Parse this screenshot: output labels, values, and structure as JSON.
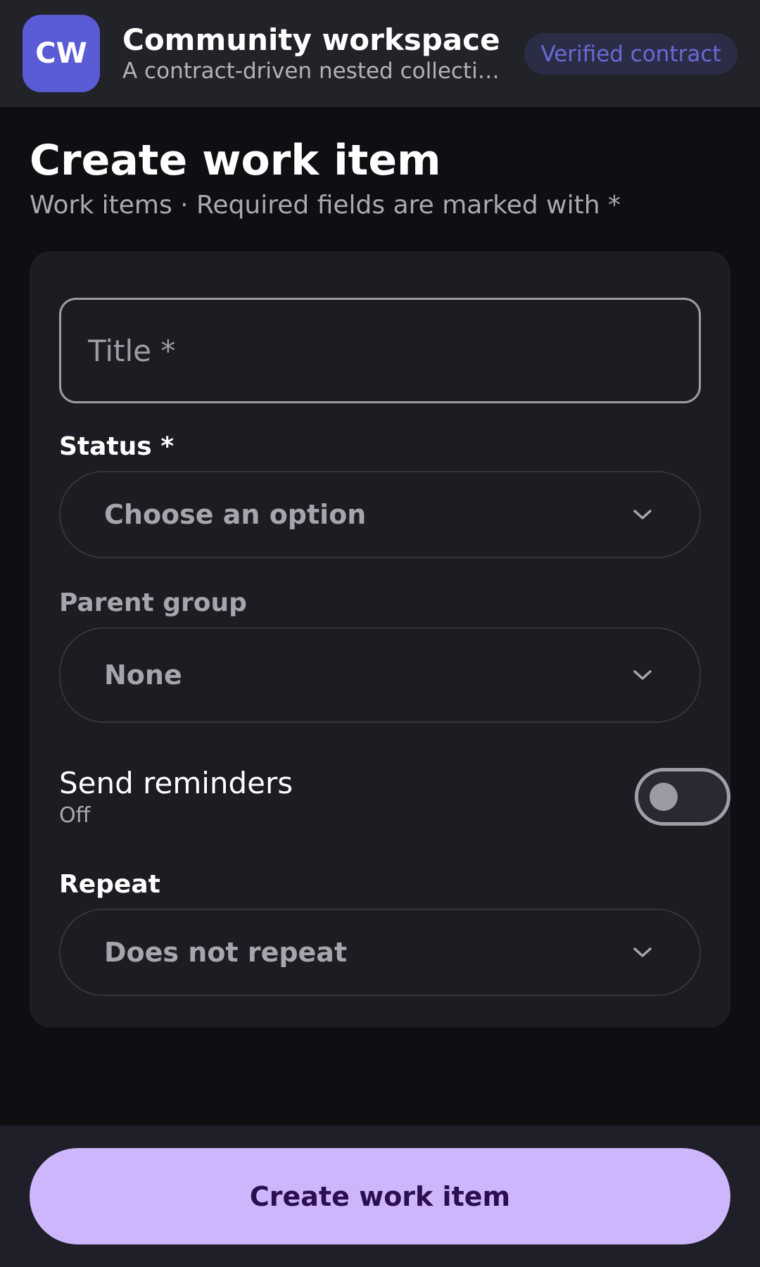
{
  "header": {
    "logo_initials": "CW",
    "title": "Community workspace",
    "subtitle": "A contract-driven nested collection editor",
    "badge": "Verified contract"
  },
  "page": {
    "title": "Create work item",
    "subtitle": "Work items · Required fields are marked with *"
  },
  "form": {
    "title_field": {
      "placeholder": "Title *",
      "value": ""
    },
    "status": {
      "label": "Status *",
      "value": "Choose an option",
      "icon": "chevron-down-icon"
    },
    "parent_group": {
      "label": "Parent group",
      "value": "None",
      "icon": "chevron-down-icon"
    },
    "reminders": {
      "label": "Send reminders",
      "state": "Off",
      "enabled": false
    },
    "repeat": {
      "label": "Repeat",
      "value": "Does not repeat",
      "icon": "chevron-down-icon"
    }
  },
  "footer": {
    "submit_label": "Create work item"
  },
  "colors": {
    "logo_bg": "#5b5bd6",
    "badge_text": "#6a6ad8",
    "primary_button_bg": "#cdb6fb",
    "primary_button_text": "#2b0f4f",
    "chevron": "#a5a6ad"
  }
}
